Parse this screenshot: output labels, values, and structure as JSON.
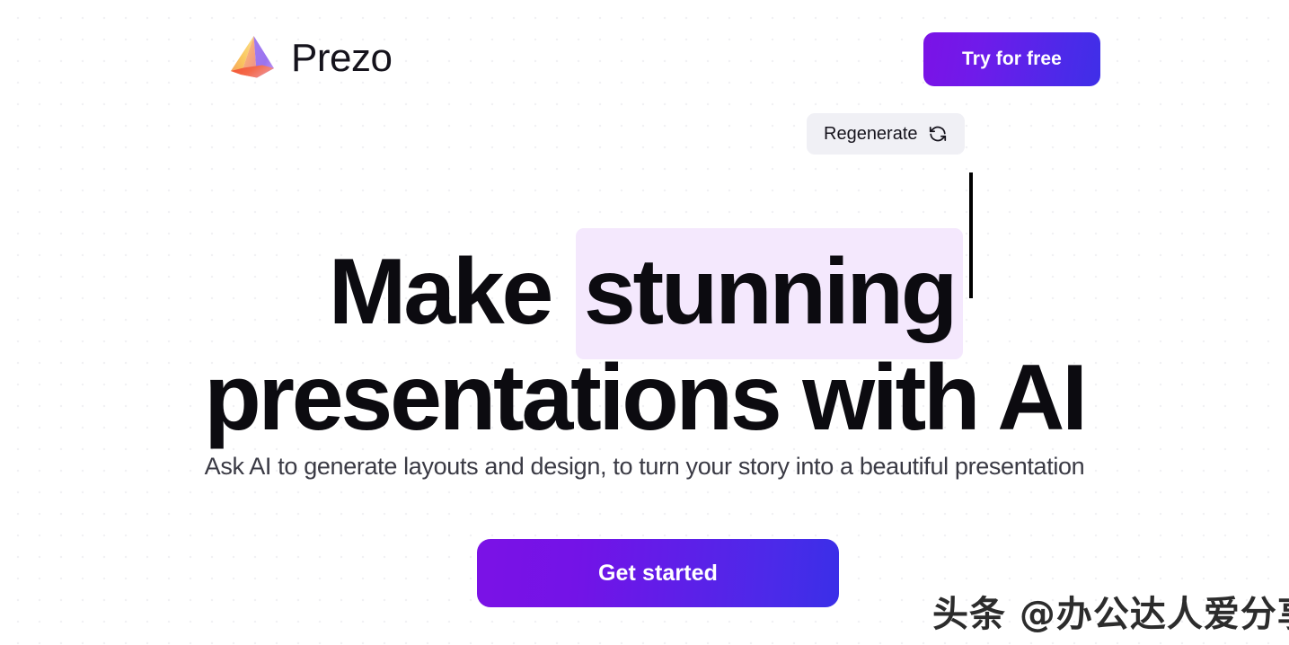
{
  "header": {
    "brand_name": "Prezo",
    "logo_icon": "pyramid-logo-icon",
    "cta_label": "Try for free"
  },
  "toolbar": {
    "regenerate_label": "Regenerate",
    "regenerate_icon": "refresh-icon"
  },
  "hero": {
    "headline_part1": "Make ",
    "headline_highlight": "stunning",
    "headline_line2": "presentations with AI",
    "subtitle": "Ask AI to generate layouts and design, to turn your story into a beautiful presentation",
    "cta_label": "Get started"
  },
  "watermark": {
    "text": "头条 @办公达人爱分享"
  },
  "colors": {
    "brand_gradient_start": "#7b12e6",
    "brand_gradient_end": "#3a2fe8",
    "highlight_background": "#f4e8fd",
    "pill_background": "#f0f0f5",
    "headline_text": "#0c0b10",
    "subtitle_text": "#3a3a44",
    "page_background": "#ffffff",
    "dot_grid": "#f1f1f4"
  }
}
